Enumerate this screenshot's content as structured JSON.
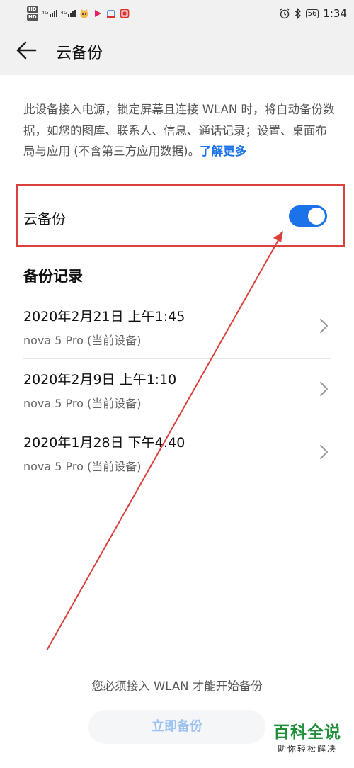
{
  "status_bar": {
    "hd_badges": [
      "HD",
      "HD"
    ],
    "network_labels": [
      "4G",
      "4G"
    ],
    "bluetooth_label": "✱",
    "battery": "56",
    "time": "1:34"
  },
  "header": {
    "title": "云备份"
  },
  "description": {
    "text": "此设备接入电源，锁定屏幕且连接 WLAN 时，将自动备份数据，如您的图库、联系人、信息、通话记录；设置、桌面布局与应用 (不含第三方应用数据)。",
    "link": "了解更多"
  },
  "cloud_backup": {
    "label": "云备份",
    "enabled": true
  },
  "records": {
    "title": "备份记录",
    "items": [
      {
        "date": "2020年2月21日 上午1:45",
        "device": "nova 5 Pro (当前设备)"
      },
      {
        "date": "2020年2月9日 上午1:10",
        "device": "nova 5 Pro (当前设备)"
      },
      {
        "date": "2020年1月28日 下午4:40",
        "device": "nova 5 Pro (当前设备)"
      }
    ]
  },
  "footer": {
    "message": "您必须接入 WLAN 才能开始备份",
    "button": "立即备份"
  },
  "watermark": {
    "title": "百科全说",
    "subtitle": "助你轻松解决"
  },
  "colors": {
    "accent": "#1a73e8",
    "highlight": "#d9413b",
    "watermark": "#1f8f3a"
  }
}
